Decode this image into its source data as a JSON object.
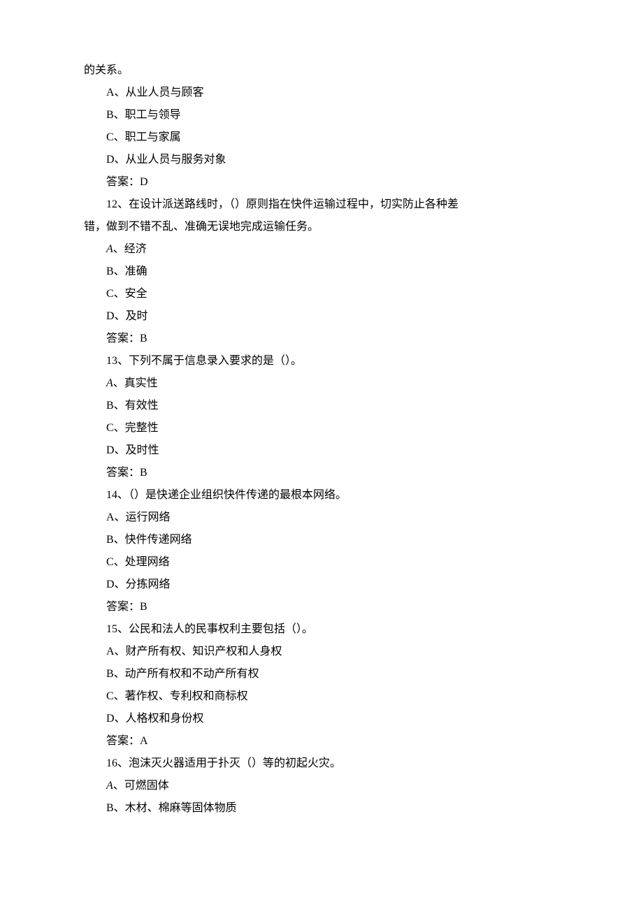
{
  "lines": [
    {
      "indent": false,
      "style": "plain",
      "text": "的关系。"
    },
    {
      "indent": true,
      "style": "plain",
      "text": "A、从业人员与顾客"
    },
    {
      "indent": true,
      "style": "plain",
      "text": "B、职工与领导"
    },
    {
      "indent": true,
      "style": "plain",
      "text": "C、职工与家属"
    },
    {
      "indent": true,
      "style": "plain",
      "text": "D、从业人员与服务对象"
    },
    {
      "indent": true,
      "style": "plain",
      "text": "答案：D"
    },
    {
      "indent": true,
      "style": "plain",
      "text": "12、在设计派送路线时，（）原则指在快件运输过程中，切实防止各种差"
    },
    {
      "indent": false,
      "style": "plain",
      "text": "错，做到不错不乱、准确无误地完成运输任务。"
    },
    {
      "indent": true,
      "style": "italicA",
      "prefix": "A",
      "rest": "、经济"
    },
    {
      "indent": true,
      "style": "plain",
      "text": "B、准确"
    },
    {
      "indent": true,
      "style": "plain",
      "text": "C、安全"
    },
    {
      "indent": true,
      "style": "plain",
      "text": "D、及时"
    },
    {
      "indent": true,
      "style": "plain",
      "text": "答案：B"
    },
    {
      "indent": true,
      "style": "plain",
      "text": "13、下列不属于信息录入要求的是（）。"
    },
    {
      "indent": true,
      "style": "italicA",
      "prefix": "A",
      "rest": "、真实性"
    },
    {
      "indent": true,
      "style": "plain",
      "text": "B、有效性"
    },
    {
      "indent": true,
      "style": "plain",
      "text": "C、完整性"
    },
    {
      "indent": true,
      "style": "plain",
      "text": "D、及时性"
    },
    {
      "indent": true,
      "style": "plain",
      "text": "答案：B"
    },
    {
      "indent": true,
      "style": "plain",
      "text": "14、（）是快递企业组织快件传递的最根本网络。"
    },
    {
      "indent": true,
      "style": "plain",
      "text": "A、运行网络"
    },
    {
      "indent": true,
      "style": "plain",
      "text": "B、快件传递网络"
    },
    {
      "indent": true,
      "style": "plain",
      "text": "C、处理网络"
    },
    {
      "indent": true,
      "style": "plain",
      "text": "D、分拣网络"
    },
    {
      "indent": true,
      "style": "plain",
      "text": "答案：B"
    },
    {
      "indent": true,
      "style": "plain",
      "text": "15、公民和法人的民事权利主要包括（）。"
    },
    {
      "indent": true,
      "style": "plain",
      "text": "A、财产所有权、知识产权和人身权"
    },
    {
      "indent": true,
      "style": "plain",
      "text": "B、动产所有权和不动产所有权"
    },
    {
      "indent": true,
      "style": "plain",
      "text": "C、著作权、专利权和商标权"
    },
    {
      "indent": true,
      "style": "plain",
      "text": "D、人格权和身份权"
    },
    {
      "indent": true,
      "style": "plain",
      "text": "答案：A"
    },
    {
      "indent": true,
      "style": "plain",
      "text": "16、泡沫灭火器适用于扑灭（）等的初起火灾。"
    },
    {
      "indent": true,
      "style": "italicA",
      "prefix": "A",
      "rest": "、可燃固体"
    },
    {
      "indent": true,
      "style": "plain",
      "text": "B、木材、棉麻等固体物质"
    }
  ]
}
